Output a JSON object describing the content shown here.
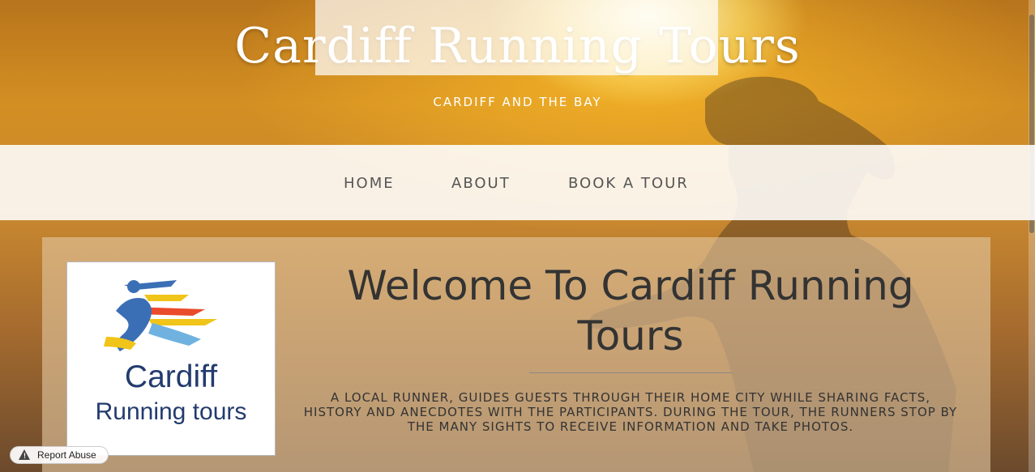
{
  "header": {
    "title": "Cardiff Running Tours",
    "tagline": "CARDIFF AND THE BAY"
  },
  "nav": {
    "items": [
      {
        "label": "HOME"
      },
      {
        "label": "ABOUT"
      },
      {
        "label": "BOOK A TOUR"
      }
    ]
  },
  "main": {
    "heading": "Welcome To Cardiff Running Tours",
    "description": "A LOCAL RUNNER, GUIDES GUESTS THROUGH THEIR HOME CITY WHILE SHARING FACTS, HISTORY AND ANECDOTES WITH THE PARTICIPANTS. DURING THE TOUR, THE RUNNERS STOP BY THE MANY SIGHTS TO RECEIVE INFORMATION AND TAKE PHOTOS."
  },
  "logo": {
    "line1": "Cardiff",
    "line2": "Running tours"
  },
  "footer": {
    "report_label": "Report Abuse"
  },
  "colors": {
    "logo_text": "#233b6e",
    "heading_text": "#333333",
    "nav_text": "#555555"
  },
  "icons": {
    "report": "warning-icon",
    "logo_figure": "runner-icon"
  }
}
